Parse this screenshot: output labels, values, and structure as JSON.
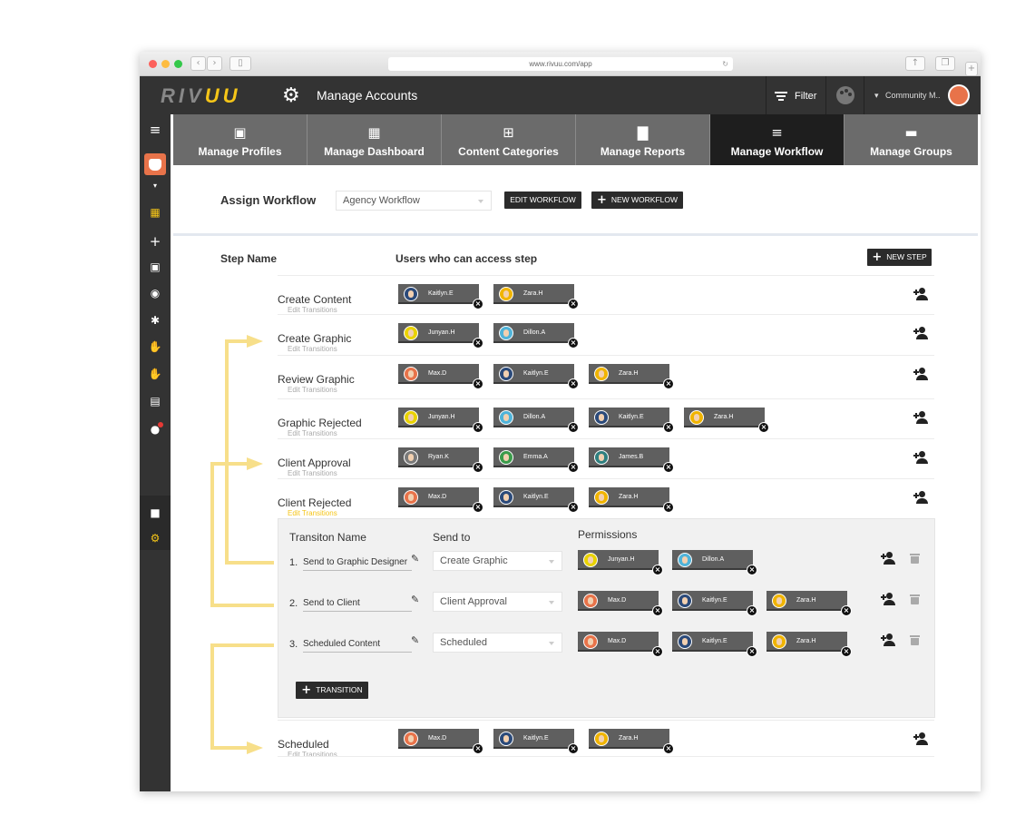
{
  "browser": {
    "url": "www.rivuu.com/app"
  },
  "header": {
    "logo_gray": "RIV",
    "logo_yellow": "UU",
    "title": "Manage Accounts",
    "filter_label": "Filter",
    "user_label": "Community M.."
  },
  "tabs": [
    {
      "label": "Manage Profiles",
      "icon": "profile-card-icon"
    },
    {
      "label": "Manage Dashboard",
      "icon": "dashboard-icon"
    },
    {
      "label": "Content Categories",
      "icon": "plus-box-icon"
    },
    {
      "label": "Manage Reports",
      "icon": "bar-chart-icon"
    },
    {
      "label": "Manage Workflow",
      "icon": "sliders-icon",
      "active": true
    },
    {
      "label": "Manage Groups",
      "icon": "folder-icon"
    }
  ],
  "assign": {
    "label": "Assign Workflow",
    "selected": "Agency Workflow",
    "edit_button": "EDIT WORKFLOW",
    "new_button": "NEW WORKFLOW"
  },
  "table": {
    "col_step": "Step Name",
    "col_users": "Users who can access step",
    "new_step": "NEW STEP",
    "edit_transitions": "Edit Transitions"
  },
  "steps": [
    {
      "name": "Create Content",
      "users": [
        "Kaitlyn.E",
        "Zara.H"
      ]
    },
    {
      "name": "Create Graphic",
      "users": [
        "Junyan.H",
        "Dillon.A"
      ]
    },
    {
      "name": "Review Graphic",
      "users": [
        "Max.D",
        "Kaitlyn.E",
        "Zara.H"
      ]
    },
    {
      "name": "Graphic Rejected",
      "users": [
        "Junyan.H",
        "Dillon.A",
        "Kaitlyn.E",
        "Zara.H"
      ]
    },
    {
      "name": "Client Approval",
      "users": [
        "Ryan.K",
        "Emma.A",
        "James.B"
      ]
    },
    {
      "name": "Client Rejected",
      "users": [
        "Max.D",
        "Kaitlyn.E",
        "Zara.H"
      ]
    },
    {
      "name": "Scheduled",
      "users": [
        "Max.D",
        "Kaitlyn.E",
        "Zara.H"
      ]
    }
  ],
  "transitions": {
    "col_name": "Transiton Name",
    "col_send": "Send to",
    "col_perm": "Permissions",
    "add_button": "TRANSITION",
    "rows": [
      {
        "num": "1.",
        "name": "Send to Graphic Designer",
        "send_to": "Create Graphic",
        "users": [
          "Junyan.H",
          "Dillon.A"
        ]
      },
      {
        "num": "2.",
        "name": "Send to Client",
        "send_to": "Client Approval",
        "users": [
          "Max.D",
          "Kaitlyn.E",
          "Zara.H"
        ]
      },
      {
        "num": "3.",
        "name": "Scheduled Content",
        "send_to": "Scheduled",
        "users": [
          "Max.D",
          "Kaitlyn.E",
          "Zara.H"
        ]
      }
    ]
  },
  "colors": {
    "accent": "#f5c518",
    "dark": "#333333",
    "chip": "#5f5f5f",
    "arrow": "#f7df8a"
  },
  "avatar_colors": {
    "Kaitlyn.E": "#2b4a7a",
    "Zara.H": "#f0b400",
    "Junyan.H": "#e9d200",
    "Dillon.A": "#4fb3d9",
    "Max.D": "#e8734a",
    "Ryan.K": "#7a7a7a",
    "Emma.A": "#3b9b4b",
    "James.B": "#2f7f7f"
  }
}
